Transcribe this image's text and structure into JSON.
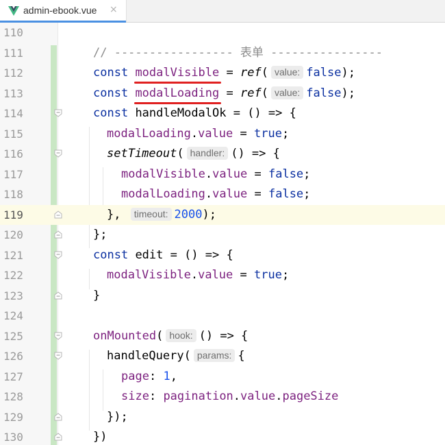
{
  "tab": {
    "title": "admin-ebook.vue",
    "close_glyph": "×",
    "icon": "vue-logo-icon",
    "accent": "#4a90e2"
  },
  "colors": {
    "keyword": "#0a2fa0",
    "variable": "#7b1f7e",
    "number": "#1750eb",
    "comment": "#8c8c8c",
    "vcs_added": "#c9e7c4",
    "current_line": "#fdfbe6",
    "annotation_underline": "#e02020"
  },
  "editor": {
    "current_line": "119",
    "lines": [
      {
        "n": "110"
      },
      {
        "n": "111",
        "comment": "// ----------------- 表单 ----------------"
      },
      {
        "n": "112",
        "kw": "const",
        "name": "modalVisible",
        "eq": " = ",
        "fn": "ref",
        "open": "(",
        "hint": "value:",
        "val": "false",
        "end": ");"
      },
      {
        "n": "113",
        "kw": "const",
        "name": "modalLoading",
        "eq": " = ",
        "fn": "ref",
        "open": "(",
        "hint": "value:",
        "val": "false",
        "end": ");"
      },
      {
        "n": "114",
        "kw": "const",
        "name": "handleModalOk",
        "rest": " = () => {"
      },
      {
        "n": "115",
        "obj": "modalLoading",
        "dot": ".",
        "prop": "value",
        "eq": " = ",
        "val": "true",
        "end": ";"
      },
      {
        "n": "116",
        "fn": "setTimeout",
        "open": "(",
        "hint": "handler:",
        "rest": "() => {"
      },
      {
        "n": "117",
        "obj": "modalVisible",
        "dot": ".",
        "prop": "value",
        "eq": " = ",
        "val": "false",
        "end": ";"
      },
      {
        "n": "118",
        "obj": "modalLoading",
        "dot": ".",
        "prop": "value",
        "eq": " = ",
        "val": "false",
        "end": ";"
      },
      {
        "n": "119",
        "pre": "},",
        "hint": "timeout:",
        "num": "2000",
        "end": ");"
      },
      {
        "n": "120",
        "text": "};"
      },
      {
        "n": "121",
        "kw": "const",
        "name": "edit",
        "rest": " = () => {"
      },
      {
        "n": "122",
        "obj": "modalVisible",
        "dot": ".",
        "prop": "value",
        "eq": " = ",
        "val": "true",
        "end": ";"
      },
      {
        "n": "123",
        "text": "}"
      },
      {
        "n": "124"
      },
      {
        "n": "125",
        "fn": "onMounted",
        "open": "(",
        "hint": "hook:",
        "rest": "() => {"
      },
      {
        "n": "126",
        "fn": "handleQuery",
        "open": "(",
        "hint": "params:",
        "rest": "{"
      },
      {
        "n": "127",
        "key": "page",
        "colon": ": ",
        "num": "1",
        "end": ","
      },
      {
        "n": "128",
        "key": "size",
        "colon": ": ",
        "obj": "pagination",
        "dot": ".",
        "prop": "value",
        "dot2": ".",
        "prop2": "pageSize"
      },
      {
        "n": "129",
        "text": "});"
      },
      {
        "n": "130",
        "text": "})"
      }
    ]
  }
}
